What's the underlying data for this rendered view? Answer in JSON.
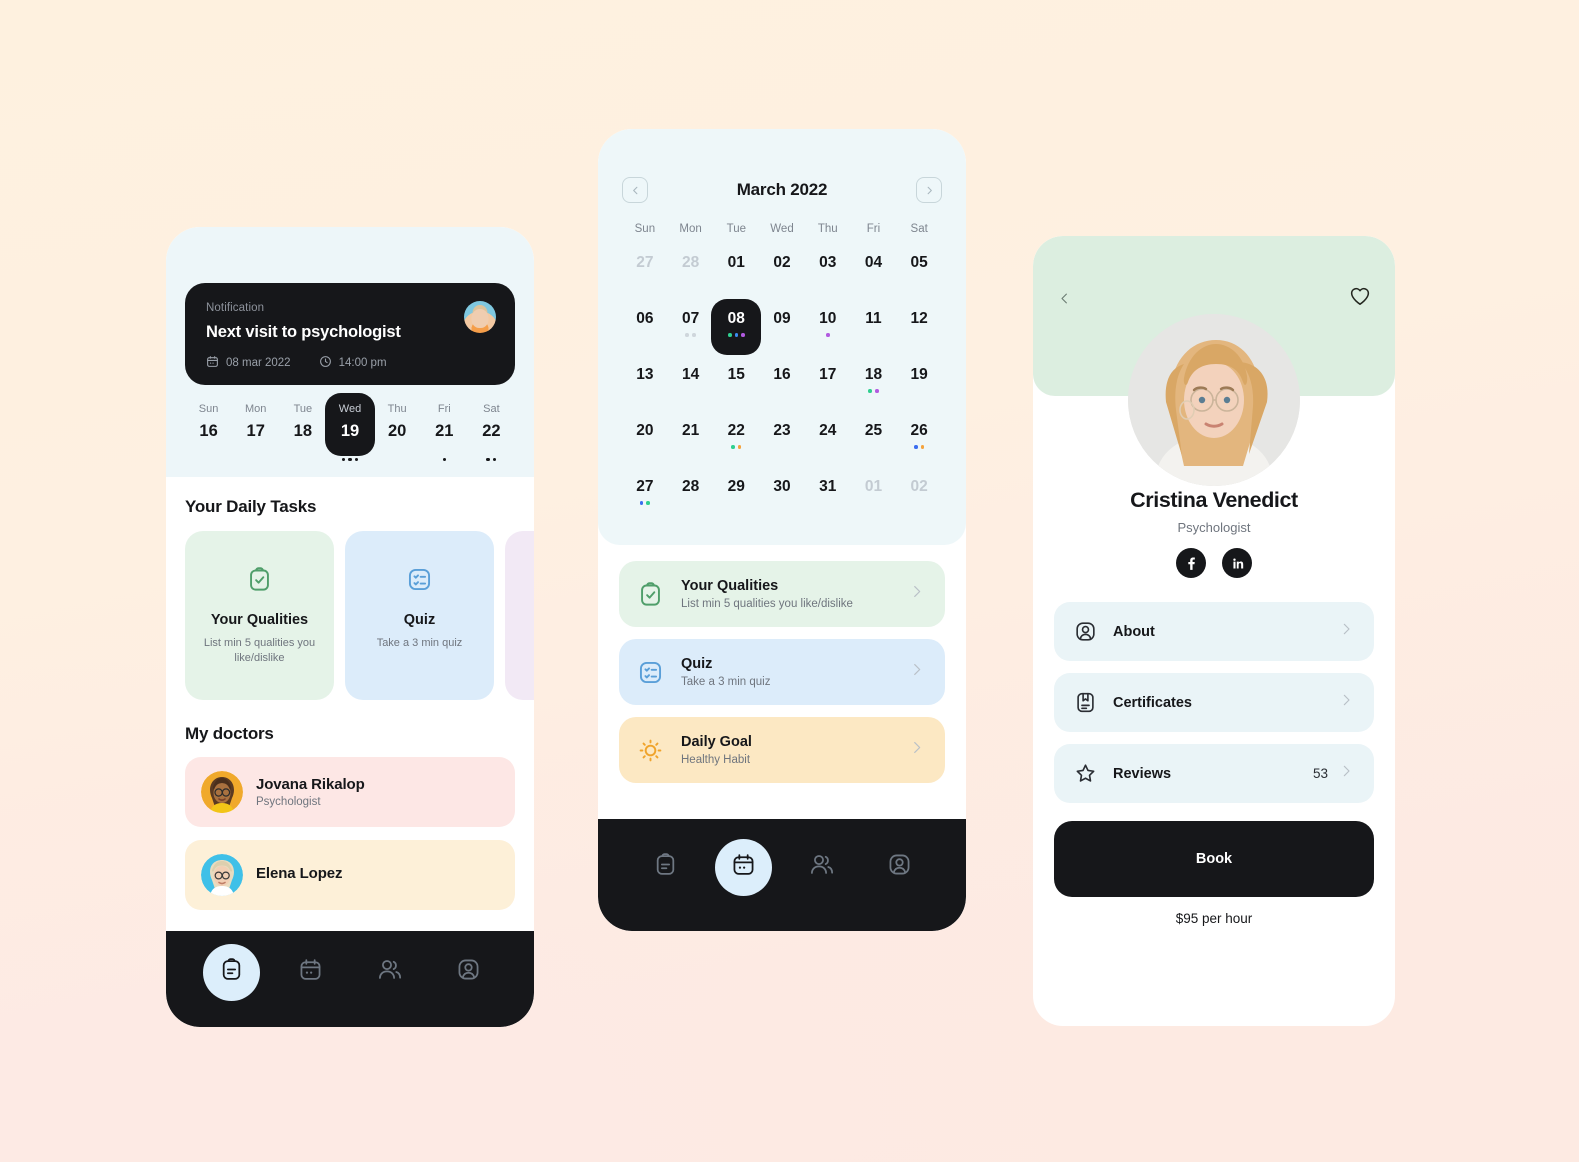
{
  "background": {
    "from": "#fef1df",
    "to": "#fde9e2"
  },
  "phone_home": {
    "notification": {
      "label": "Notification",
      "title": "Next visit to psychologist",
      "date": "08 mar 2022",
      "time": "14:00 pm",
      "calendar_icon": "calendar-icon",
      "clock_icon": "clock-icon",
      "avatar": "patient-avatar"
    },
    "week": {
      "days": [
        {
          "dow": "Sun",
          "num": "16",
          "selected": false,
          "dots": []
        },
        {
          "dow": "Mon",
          "num": "17",
          "selected": false,
          "dots": []
        },
        {
          "dow": "Tue",
          "num": "18",
          "selected": false,
          "dots": []
        },
        {
          "dow": "Wed",
          "num": "19",
          "selected": true,
          "dots": [
            "#16171a",
            "#16171a",
            "#16171a"
          ]
        },
        {
          "dow": "Thu",
          "num": "20",
          "selected": false,
          "dots": []
        },
        {
          "dow": "Fri",
          "num": "21",
          "selected": false,
          "dots": [
            "#16171a"
          ]
        },
        {
          "dow": "Sat",
          "num": "22",
          "selected": false,
          "dots": [
            "#16171a",
            "#16171a"
          ]
        }
      ]
    },
    "tasks_heading": "Your Daily Tasks",
    "tasks": [
      {
        "title": "Your Qualities",
        "desc": "List min 5 qualities you like/dislike",
        "bg": "#e5f3e8",
        "icon": "clipboard-check-icon",
        "icon_color": "#4f9e6a"
      },
      {
        "title": "Quiz",
        "desc": "Take a 3 min quiz",
        "bg": "#dcecfa",
        "icon": "quiz-list-icon",
        "icon_color": "#5a9fd8"
      },
      {
        "title": "",
        "desc": "",
        "bg": "#f2e9f5",
        "icon": "",
        "icon_color": ""
      }
    ],
    "doctors_heading": "My doctors",
    "doctors": [
      {
        "name": "Jovana Rikalop",
        "role": "Psychologist",
        "bg": "#fde7e5"
      },
      {
        "name": "Elena Lopez",
        "role": "",
        "bg": "#fdf0d8"
      }
    ],
    "nav": [
      {
        "icon": "clipboard-icon",
        "active": true
      },
      {
        "icon": "calendar-icon",
        "active": false
      },
      {
        "icon": "people-icon",
        "active": false
      },
      {
        "icon": "profile-icon",
        "active": false
      }
    ]
  },
  "phone_calendar": {
    "month_title": "March 2022",
    "prev_icon": "chevron-left-icon",
    "next_icon": "chevron-right-icon",
    "dow_labels": [
      "Sun",
      "Mon",
      "Tue",
      "Wed",
      "Thu",
      "Fri",
      "Sat"
    ],
    "weeks": [
      [
        {
          "n": "27",
          "muted": true,
          "selected": false,
          "dots": []
        },
        {
          "n": "28",
          "muted": true,
          "selected": false,
          "dots": []
        },
        {
          "n": "01",
          "muted": false,
          "selected": false,
          "dots": []
        },
        {
          "n": "02",
          "muted": false,
          "selected": false,
          "dots": []
        },
        {
          "n": "03",
          "muted": false,
          "selected": false,
          "dots": []
        },
        {
          "n": "04",
          "muted": false,
          "selected": false,
          "dots": []
        },
        {
          "n": "05",
          "muted": false,
          "selected": false,
          "dots": []
        }
      ],
      [
        {
          "n": "06",
          "muted": false,
          "selected": false,
          "dots": []
        },
        {
          "n": "07",
          "muted": false,
          "selected": false,
          "dots": [
            "#cfd6dc",
            "#cfd6dc"
          ]
        },
        {
          "n": "08",
          "muted": false,
          "selected": true,
          "dots": [
            "#2fcf8f",
            "#3a8df0",
            "#b15ae0"
          ]
        },
        {
          "n": "09",
          "muted": false,
          "selected": false,
          "dots": []
        },
        {
          "n": "10",
          "muted": false,
          "selected": false,
          "dots": [
            "#b15ae0"
          ]
        },
        {
          "n": "11",
          "muted": false,
          "selected": false,
          "dots": []
        },
        {
          "n": "12",
          "muted": false,
          "selected": false,
          "dots": []
        }
      ],
      [
        {
          "n": "13",
          "muted": false,
          "selected": false,
          "dots": []
        },
        {
          "n": "14",
          "muted": false,
          "selected": false,
          "dots": []
        },
        {
          "n": "15",
          "muted": false,
          "selected": false,
          "dots": []
        },
        {
          "n": "16",
          "muted": false,
          "selected": false,
          "dots": []
        },
        {
          "n": "17",
          "muted": false,
          "selected": false,
          "dots": []
        },
        {
          "n": "18",
          "muted": false,
          "selected": false,
          "dots": [
            "#2fcf8f",
            "#b15ae0"
          ]
        },
        {
          "n": "19",
          "muted": false,
          "selected": false,
          "dots": []
        }
      ],
      [
        {
          "n": "20",
          "muted": false,
          "selected": false,
          "dots": []
        },
        {
          "n": "21",
          "muted": false,
          "selected": false,
          "dots": []
        },
        {
          "n": "22",
          "muted": false,
          "selected": false,
          "dots": [
            "#2fcf8f",
            "#f5a33c"
          ]
        },
        {
          "n": "23",
          "muted": false,
          "selected": false,
          "dots": []
        },
        {
          "n": "24",
          "muted": false,
          "selected": false,
          "dots": []
        },
        {
          "n": "25",
          "muted": false,
          "selected": false,
          "dots": []
        },
        {
          "n": "26",
          "muted": false,
          "selected": false,
          "dots": [
            "#3a6df0",
            "#f5a33c"
          ]
        }
      ],
      [
        {
          "n": "27",
          "muted": false,
          "selected": false,
          "dots": [
            "#3a6df0",
            "#2fcf8f"
          ]
        },
        {
          "n": "28",
          "muted": false,
          "selected": false,
          "dots": []
        },
        {
          "n": "29",
          "muted": false,
          "selected": false,
          "dots": []
        },
        {
          "n": "30",
          "muted": false,
          "selected": false,
          "dots": []
        },
        {
          "n": "31",
          "muted": false,
          "selected": false,
          "dots": []
        },
        {
          "n": "01",
          "muted": true,
          "selected": false,
          "dots": []
        },
        {
          "n": "02",
          "muted": true,
          "selected": false,
          "dots": []
        }
      ]
    ],
    "tasks": [
      {
        "title": "Your Qualities",
        "desc": "List min 5 qualities you like/dislike",
        "bg": "#e5f3e8",
        "icon": "clipboard-check-icon",
        "icon_color": "#4f9e6a",
        "chevron": "chevron-right-icon"
      },
      {
        "title": "Quiz",
        "desc": "Take a 3 min quiz",
        "bg": "#dcecfa",
        "icon": "quiz-list-icon",
        "icon_color": "#5a9fd8",
        "chevron": "chevron-right-icon"
      },
      {
        "title": "Daily Goal",
        "desc": "Healthy Habit",
        "bg": "#fce8c3",
        "icon": "sun-icon",
        "icon_color": "#f0a32a",
        "chevron": "chevron-right-icon"
      }
    ],
    "nav": [
      {
        "icon": "clipboard-icon",
        "active": false
      },
      {
        "icon": "calendar-icon",
        "active": true
      },
      {
        "icon": "people-icon",
        "active": false
      },
      {
        "icon": "profile-icon",
        "active": false
      }
    ]
  },
  "phone_profile": {
    "back_icon": "chevron-left-icon",
    "favorite_icon": "heart-icon",
    "avatar": "doctor-avatar",
    "name": "Cristina Venedict",
    "role": "Psychologist",
    "social": [
      {
        "icon": "facebook-icon"
      },
      {
        "icon": "linkedin-icon"
      }
    ],
    "menu": [
      {
        "label": "About",
        "icon": "user-circle-icon",
        "count": "",
        "chevron": "chevron-right-icon"
      },
      {
        "label": "Certificates",
        "icon": "certificate-icon",
        "count": "",
        "chevron": "chevron-right-icon"
      },
      {
        "label": "Reviews",
        "icon": "star-icon",
        "count": "53",
        "chevron": "chevron-right-icon"
      }
    ],
    "book_label": "Book",
    "price": "$95 per hour",
    "hero_bg": "#dceee0"
  }
}
